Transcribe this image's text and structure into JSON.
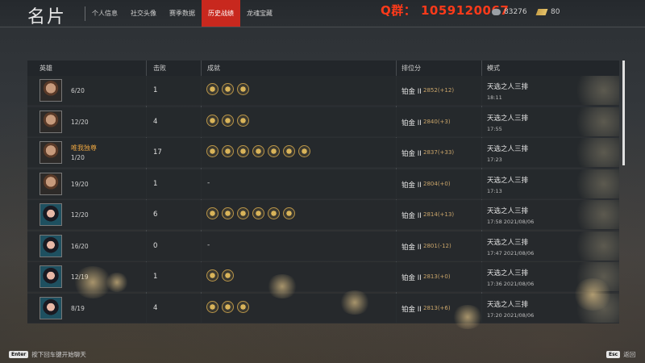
{
  "header": {
    "title": "名片",
    "tabs": [
      "个人信息",
      "社交头像",
      "赛季数据",
      "历史战绩",
      "龙魂宝藏"
    ],
    "active_tab": "历史战绩",
    "promo": "Q群： 1059120067",
    "coins": "83276",
    "gold": "80"
  },
  "table": {
    "headers": {
      "hero": "英雄",
      "kills": "击败",
      "achievements": "成就",
      "rank_score": "排位分",
      "mode": "模式"
    },
    "rows": [
      {
        "avatar": "male-hero-avatar",
        "name": "",
        "frac": "6/20",
        "kills": "1",
        "ach_count": 3,
        "rank": "铂金 II",
        "score": "2852(+12)",
        "mode": "天选之人三排",
        "time": "18:11"
      },
      {
        "avatar": "male-hero-avatar",
        "name": "",
        "frac": "12/20",
        "kills": "4",
        "ach_count": 3,
        "rank": "铂金 II",
        "score": "2840(+3)",
        "mode": "天选之人三排",
        "time": "17:55"
      },
      {
        "avatar": "male-hero-avatar",
        "name": "唯我独尊",
        "frac": "1/20",
        "kills": "17",
        "ach_count": 7,
        "rank": "铂金 II",
        "score": "2837(+33)",
        "mode": "天选之人三排",
        "time": "17:23"
      },
      {
        "avatar": "male-hero-avatar",
        "name": "",
        "frac": "19/20",
        "kills": "1",
        "ach_count": 0,
        "rank": "铂金 II",
        "score": "2804(+0)",
        "mode": "天选之人三排",
        "time": "17:13"
      },
      {
        "avatar": "female-hero-avatar",
        "name": "",
        "frac": "12/20",
        "kills": "6",
        "ach_count": 6,
        "rank": "铂金 II",
        "score": "2814(+13)",
        "mode": "天选之人三排",
        "time": "17:58  2021/08/06"
      },
      {
        "avatar": "female-hero-avatar",
        "name": "",
        "frac": "16/20",
        "kills": "0",
        "ach_count": 0,
        "rank": "铂金 II",
        "score": "2801(-12)",
        "mode": "天选之人三排",
        "time": "17:47  2021/08/06"
      },
      {
        "avatar": "female-hero-avatar",
        "name": "",
        "frac": "12/19",
        "kills": "1",
        "ach_count": 2,
        "rank": "铂金 II",
        "score": "2813(+0)",
        "mode": "天选之人三排",
        "time": "17:36  2021/08/06"
      },
      {
        "avatar": "female-hero-avatar",
        "name": "",
        "frac": "8/19",
        "kills": "4",
        "ach_count": 3,
        "rank": "铂金 II",
        "score": "2813(+6)",
        "mode": "天选之人三排",
        "time": "17:20  2021/08/06"
      }
    ],
    "empty_achievement": "-"
  },
  "footer": {
    "enter_key": "Enter",
    "chat_hint": "按下回车键开始聊天",
    "esc_key": "Esc",
    "back": "返回"
  },
  "colors": {
    "active_tab": "#c8281e",
    "promo": "#ff3a1a",
    "name_highlight": "#e6a240",
    "score": "#caa56a"
  }
}
